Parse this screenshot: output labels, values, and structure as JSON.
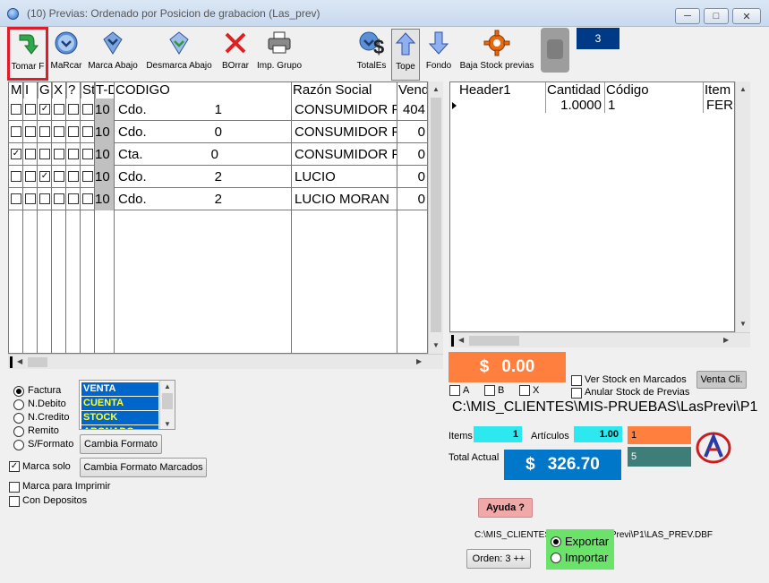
{
  "window": {
    "title": "(10) Previas: Ordenado por Posicion de grabacion (Las_prev)"
  },
  "toolbar": {
    "tomar": "Tomar F",
    "marcar": "MaRcar",
    "marca_abajo": "Marca Abajo",
    "desmarca_abajo": "Desmarca Abajo",
    "borrar": "BOrrar",
    "imp_grupo": "Imp. Grupo",
    "totales": "TotalEs",
    "tope": "Tope",
    "fondo": "Fondo",
    "baja_stock": "Baja Stock previas",
    "counter": "3"
  },
  "left_grid": {
    "headers": [
      "M",
      "I",
      "G",
      "X",
      "?",
      "St",
      "T-D",
      "CODIGO",
      "Razón Social",
      "Vend"
    ],
    "rows": [
      {
        "cb": [
          false,
          false,
          true,
          false,
          false,
          false
        ],
        "td": "10",
        "tipo": "Cdo.",
        "num": "1",
        "razon": "CONSUMIDOR F",
        "vend": "404",
        "current": false
      },
      {
        "cb": [
          false,
          false,
          false,
          false,
          false,
          false
        ],
        "td": "10",
        "tipo": "Cdo.",
        "num": "0",
        "razon": "CONSUMIDOR F",
        "vend": "0",
        "current": false
      },
      {
        "cb": [
          true,
          false,
          false,
          false,
          false,
          false
        ],
        "td": "10",
        "tipo": "Cta.",
        "num": "0",
        "razon": "CONSUMIDOR F",
        "vend": "0",
        "current": false
      },
      {
        "cb": [
          false,
          false,
          true,
          false,
          false,
          false
        ],
        "td": "10",
        "tipo": "Cdo.",
        "num": "2",
        "razon": "LUCIO",
        "vend": "0",
        "current": false
      },
      {
        "cb": [
          false,
          false,
          false,
          false,
          false,
          false
        ],
        "td": "10",
        "tipo": "Cdo.",
        "num": "2",
        "razon": "LUCIO MORAN",
        "vend": "0",
        "current": true
      }
    ]
  },
  "right_grid": {
    "headers": [
      "Header1",
      "Cantidad",
      "Código",
      "Item"
    ],
    "rows": [
      {
        "header1": "",
        "cantidad": "1.0000",
        "codigo": "1",
        "item": "FER"
      }
    ]
  },
  "totals": {
    "currency": "$",
    "amount": "0.00",
    "ver_stock": "Ver Stock en Marcados",
    "anular_stock": "Anular Stock de Previas",
    "venta_cli": "Venta Cli.",
    "cb_a": "A",
    "cb_b": "B",
    "cb_x": "X",
    "path": "C:\\MIS_CLIENTES\\MIS-PRUEBAS\\LasPrevi\\P1",
    "items_label": "Items",
    "items_value": "1",
    "articulos_label": "Artículos",
    "articulos_value": "1.00",
    "orange_value": "1",
    "teal_value": "5",
    "total_actual_label": "Total Actual",
    "total_actual_currency": "$",
    "total_actual_amount": "326.70"
  },
  "left_panel": {
    "radio": [
      "Factura",
      "N.Debito",
      "N.Credito",
      "Remito",
      "S/Formato"
    ],
    "radio_selected": 0,
    "list": [
      "VENTA",
      "CUENTA",
      "STOCK",
      "ABONADO"
    ],
    "cambia_formato": "Cambia Formato",
    "marca_solo": "Marca solo",
    "cambia_formato_marcados": "Cambia Formato Marcados",
    "marca_imprimir": "Marca para Imprimir",
    "con_depositos": "Con Depositos"
  },
  "bottom": {
    "ayuda": "Ayuda ?",
    "dbf_path": "C:\\MIS_CLIENTES\\MIS-PRUEBAS\\LasPrevi\\P1\\LAS_PREV.DBF",
    "orden": "Orden: 3 ++",
    "exportar": "Exportar",
    "importar": "Importar"
  },
  "colors": {
    "accent_orange": "#ff7f3f",
    "accent_blue": "#0077c8",
    "highlight_red": "#e01c2a",
    "export_green": "#6be36b"
  }
}
